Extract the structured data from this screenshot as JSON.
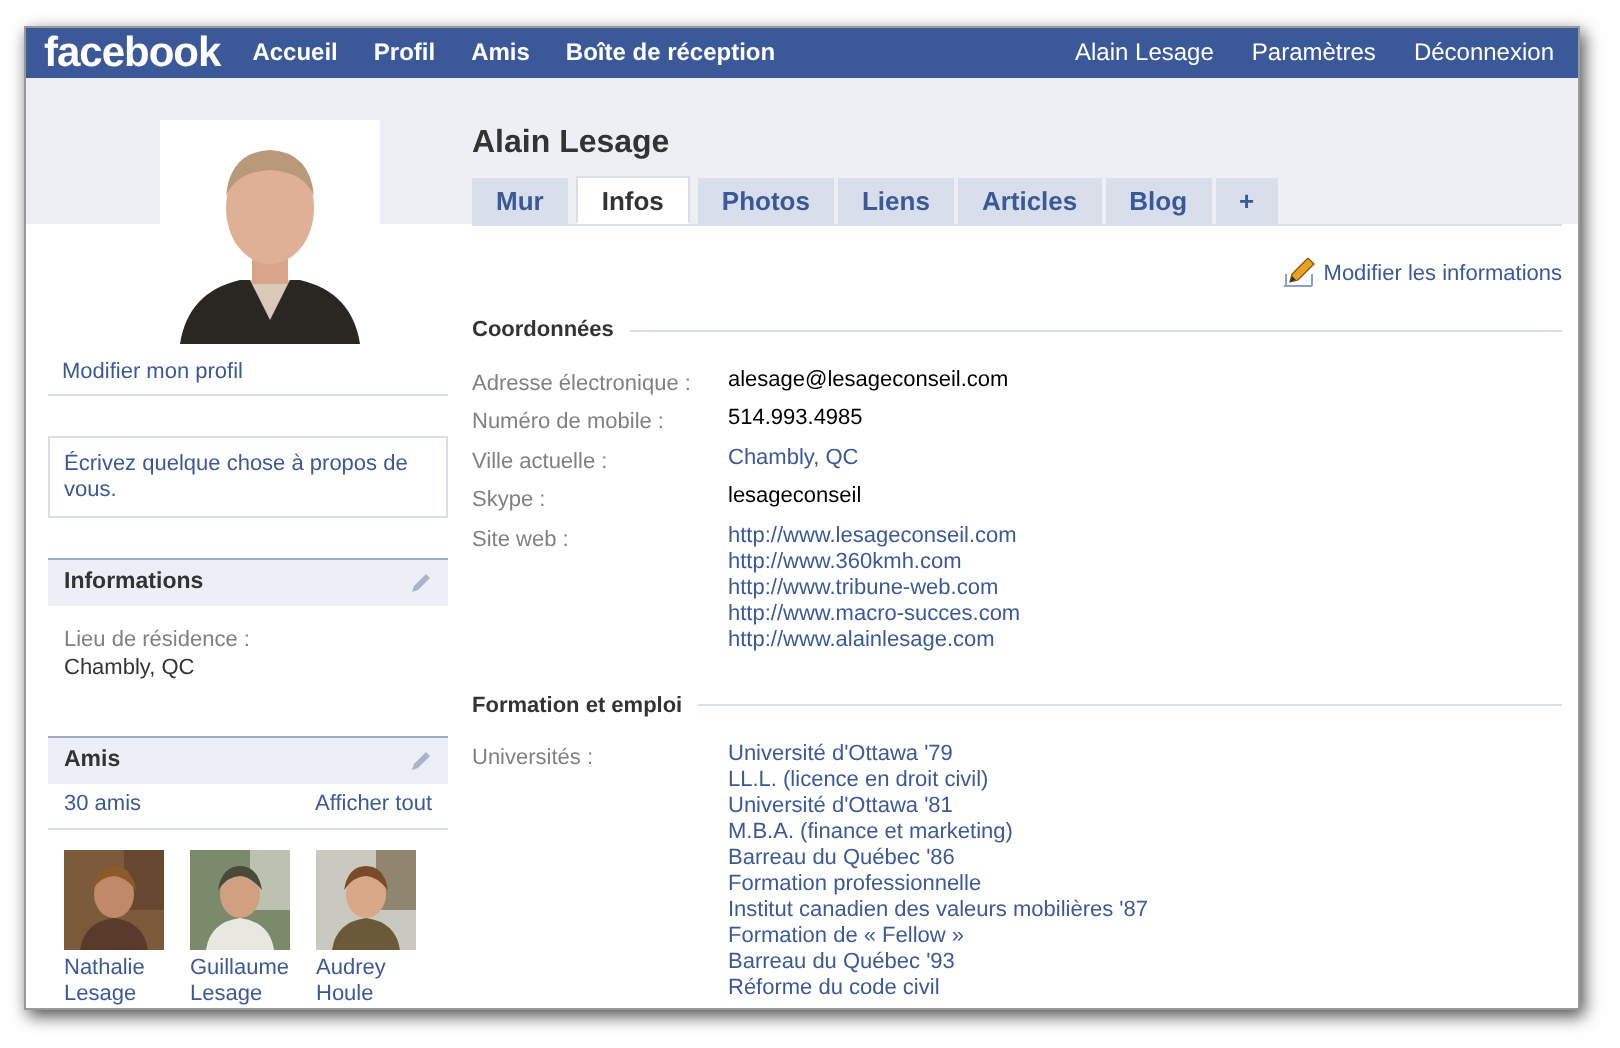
{
  "nav": {
    "logo": "facebook",
    "left": [
      "Accueil",
      "Profil",
      "Amis",
      "Boîte de réception"
    ],
    "right": [
      "Alain Lesage",
      "Paramètres",
      "Déconnexion"
    ]
  },
  "sidebar": {
    "edit_profile": "Modifier mon profil",
    "about_prompt": "Écrivez quelque chose à propos de vous.",
    "informations": {
      "title": "Informations",
      "label": "Lieu de résidence :",
      "value": "Chambly, QC"
    },
    "friends": {
      "title": "Amis",
      "count": "30 amis",
      "see_all": "Afficher tout",
      "items": [
        {
          "first": "Nathalie",
          "last": "Lesage"
        },
        {
          "first": "Guillaume",
          "last": "Lesage"
        },
        {
          "first": "Audrey",
          "last": "Houle"
        }
      ]
    }
  },
  "profile": {
    "name": "Alain Lesage",
    "tabs": [
      {
        "label": "Mur",
        "selected": false
      },
      {
        "label": "Infos",
        "selected": true
      },
      {
        "label": "Photos",
        "selected": false
      },
      {
        "label": "Liens",
        "selected": false
      },
      {
        "label": "Articles",
        "selected": false
      },
      {
        "label": "Blog",
        "selected": false
      },
      {
        "label": "+",
        "selected": false
      }
    ],
    "edit_info": "Modifier les informations",
    "sections": [
      {
        "title": "Coordonnées",
        "rows": [
          {
            "label": "Adresse électronique :",
            "values": [
              {
                "text": "alesage@lesageconseil.com",
                "kind": "plain"
              }
            ]
          },
          {
            "label": "Numéro de mobile :",
            "values": [
              {
                "text": "514.993.4985",
                "kind": "plain"
              }
            ]
          },
          {
            "label": "Ville actuelle :",
            "values": [
              {
                "text": "Chambly, QC",
                "kind": "link"
              }
            ]
          },
          {
            "label": "Skype :",
            "values": [
              {
                "text": "lesageconseil",
                "kind": "plain"
              }
            ]
          },
          {
            "label": "Site web :",
            "values": [
              {
                "text": "http://www.lesageconseil.com",
                "kind": "link"
              },
              {
                "text": "http://www.360kmh.com",
                "kind": "link"
              },
              {
                "text": "http://www.tribune-web.com",
                "kind": "link"
              },
              {
                "text": "http://www.macro-succes.com",
                "kind": "link"
              },
              {
                "text": "http://www.alainlesage.com",
                "kind": "link"
              }
            ]
          }
        ]
      },
      {
        "title": "Formation et emploi",
        "rows": [
          {
            "label": "Universités :",
            "values": [
              {
                "text": "Université d'Ottawa '79",
                "kind": "link"
              },
              {
                "text": "LL.L. (licence en droit civil)",
                "kind": "link"
              },
              {
                "text": "Université d'Ottawa '81",
                "kind": "link"
              },
              {
                "text": "M.B.A. (finance et marketing)",
                "kind": "link"
              },
              {
                "text": "Barreau du Québec '86",
                "kind": "link"
              },
              {
                "text": "Formation professionnelle",
                "kind": "link"
              },
              {
                "text": "Institut canadien des valeurs mobilières '87",
                "kind": "link"
              },
              {
                "text": "Formation de « Fellow »",
                "kind": "link"
              },
              {
                "text": "Barreau du Québec '93",
                "kind": "link"
              },
              {
                "text": "Réforme du code civil",
                "kind": "link"
              }
            ]
          }
        ]
      }
    ]
  }
}
